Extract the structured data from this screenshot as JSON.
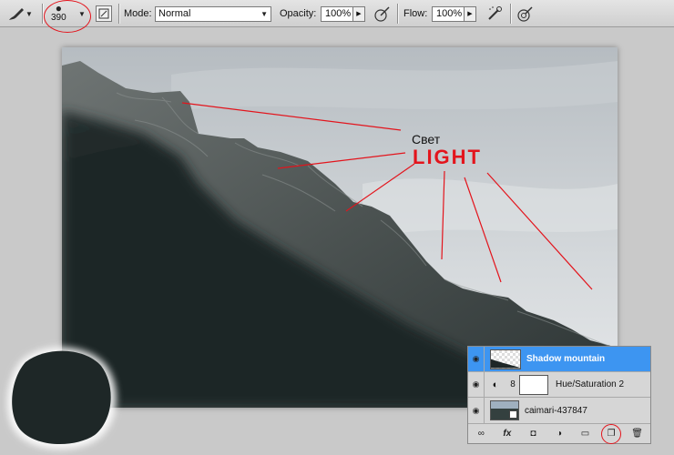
{
  "toolbar": {
    "brush_size": "390",
    "mode_label": "Mode:",
    "mode_value": "Normal",
    "opacity_label": "Opacity:",
    "opacity_value": "100%",
    "flow_label": "Flow:",
    "flow_value": "100%"
  },
  "annotation": {
    "ru": "Свет",
    "en": "LIGHT"
  },
  "layers": {
    "rows": [
      {
        "name": "Shadow mountain",
        "selected": true
      },
      {
        "name": "Hue/Saturation 2",
        "selected": false
      },
      {
        "name": "caimari-437847",
        "selected": false
      }
    ],
    "footer_fx": "fx"
  },
  "colors": {
    "highlight": "#e3141c",
    "selected_layer": "#3d95f1",
    "shadow": "#1e2727"
  }
}
